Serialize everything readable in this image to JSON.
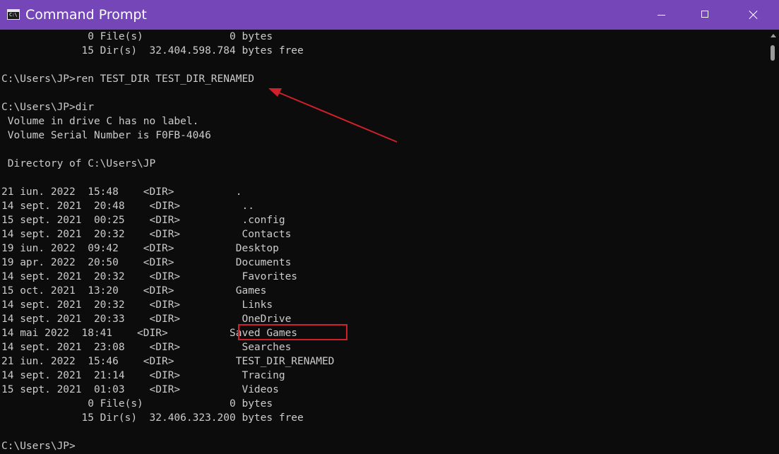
{
  "window": {
    "title": "Command Prompt",
    "app_icon_glyph": "C:\\",
    "icons": {
      "app": "command-prompt-icon",
      "minimize": "minimize-icon",
      "maximize": "maximize-icon",
      "close": "close-icon"
    },
    "colors": {
      "titlebar": "#7446b8",
      "console_bg": "#0c0c0c",
      "console_text": "#cccccc",
      "annotation": "#d0202a"
    }
  },
  "console": {
    "lines": [
      "              0 File(s)              0 bytes",
      "             15 Dir(s)  32.404.598.784 bytes free",
      "",
      "C:\\Users\\JP>ren TEST_DIR TEST_DIR_RENAMED",
      "",
      "C:\\Users\\JP>dir",
      " Volume in drive C has no label.",
      " Volume Serial Number is F0FB-4046",
      "",
      " Directory of C:\\Users\\JP",
      "",
      "21 iun. 2022  15:48    <DIR>          .",
      "14 sept. 2021  20:48    <DIR>          ..",
      "15 sept. 2021  00:25    <DIR>          .config",
      "14 sept. 2021  20:32    <DIR>          Contacts",
      "19 iun. 2022  09:42    <DIR>          Desktop",
      "19 apr. 2022  20:50    <DIR>          Documents",
      "14 sept. 2021  20:32    <DIR>          Favorites",
      "15 oct. 2021  13:20    <DIR>          Games",
      "14 sept. 2021  20:32    <DIR>          Links",
      "14 sept. 2021  20:33    <DIR>          OneDrive",
      "14 mai 2022  18:41    <DIR>          Saved Games",
      "14 sept. 2021  23:08    <DIR>          Searches",
      "21 iun. 2022  15:46    <DIR>          TEST_DIR_RENAMED",
      "14 sept. 2021  21:14    <DIR>          Tracing",
      "15 sept. 2021  01:03    <DIR>          Videos",
      "              0 File(s)              0 bytes",
      "             15 Dir(s)  32.406.323.200 bytes free",
      "",
      "C:\\Users\\JP>"
    ]
  }
}
